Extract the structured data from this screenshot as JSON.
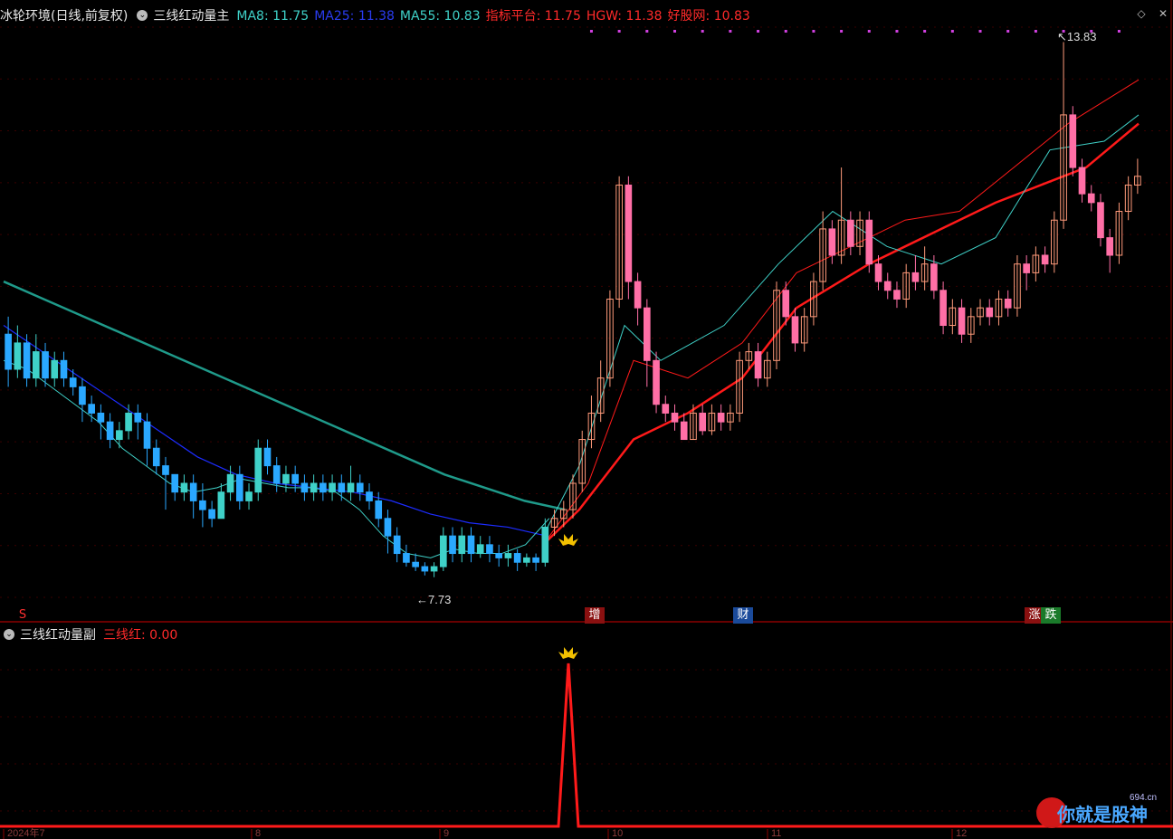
{
  "main_panel": {
    "stock_name": "冰轮环境",
    "period": "(日线,前复权)",
    "indicator_name": "三线红动量主",
    "legend": [
      {
        "label": "MA8: 11.75",
        "color": "#3fd1c8"
      },
      {
        "label": "MA25: 11.38",
        "color": "#2a3cf0"
      },
      {
        "label": "MA55: 10.83",
        "color": "#3fd1c8"
      },
      {
        "label": "指标平台: 11.75",
        "color": "#ff2a2a"
      },
      {
        "label": "HGW: 11.38",
        "color": "#ff2a2a"
      },
      {
        "label": "好股网: 10.83",
        "color": "#ff2a2a"
      }
    ],
    "high_label": "13.83",
    "low_label": "7.73",
    "markers": [
      {
        "text": "S",
        "color": "#ff3030",
        "bg": "transparent"
      },
      {
        "text": "增",
        "color": "#fff",
        "bg": "#8a1010"
      },
      {
        "text": "财",
        "color": "#fff",
        "bg": "#1a4a9a"
      },
      {
        "text": "涨",
        "color": "#fff",
        "bg": "#8a1010"
      },
      {
        "text": "跌",
        "color": "#fff",
        "bg": "#1a7a2a"
      }
    ]
  },
  "sub_panel": {
    "indicator_name": "三线红动量副",
    "value_label": "三线红: 0.00"
  },
  "x_axis_labels": [
    "2024年7",
    "8",
    "9",
    "10",
    "11",
    "12"
  ],
  "watermark": {
    "brand": "你就是股神",
    "url": "694.cn"
  },
  "colors": {
    "up": "#ff6fa6",
    "down": "#2aa8ff",
    "up_alt": "#ff9a7a",
    "cyan": "#3fd1c8",
    "blue": "#1c2cff",
    "teal": "#1f9a8a",
    "red": "#ff1a1a",
    "axis": "#8b0000"
  },
  "chart_data": {
    "type": "candlestick",
    "price_range": [
      7.5,
      14.0
    ],
    "candles": [
      [
        10.5,
        10.1,
        10.7,
        9.9
      ],
      [
        10.1,
        10.4,
        10.6,
        10.0
      ],
      [
        10.4,
        10.0,
        10.5,
        9.9
      ],
      [
        10.0,
        10.3,
        10.5,
        9.9
      ],
      [
        10.3,
        10.0,
        10.4,
        9.9
      ],
      [
        10.0,
        10.2,
        10.3,
        9.9
      ],
      [
        10.2,
        10.0,
        10.3,
        9.9
      ],
      [
        10.0,
        9.9,
        10.1,
        9.8
      ],
      [
        9.9,
        9.7,
        10.0,
        9.5
      ],
      [
        9.7,
        9.6,
        9.8,
        9.5
      ],
      [
        9.6,
        9.5,
        9.7,
        9.3
      ],
      [
        9.5,
        9.3,
        9.6,
        9.2
      ],
      [
        9.3,
        9.4,
        9.5,
        9.2
      ],
      [
        9.4,
        9.6,
        9.7,
        9.3
      ],
      [
        9.6,
        9.5,
        9.7,
        9.3
      ],
      [
        9.5,
        9.2,
        9.6,
        9.0
      ],
      [
        9.2,
        9.0,
        9.3,
        8.9
      ],
      [
        9.0,
        8.9,
        9.1,
        8.5
      ],
      [
        8.9,
        8.7,
        8.9,
        8.6
      ],
      [
        8.7,
        8.8,
        8.9,
        8.6
      ],
      [
        8.8,
        8.6,
        8.9,
        8.4
      ],
      [
        8.6,
        8.5,
        8.8,
        8.3
      ],
      [
        8.5,
        8.4,
        8.6,
        8.3
      ],
      [
        8.4,
        8.7,
        8.8,
        8.4
      ],
      [
        8.7,
        8.9,
        9.0,
        8.6
      ],
      [
        8.9,
        8.6,
        9.0,
        8.5
      ],
      [
        8.6,
        8.7,
        8.8,
        8.5
      ],
      [
        8.7,
        9.2,
        9.3,
        8.6
      ],
      [
        9.2,
        9.0,
        9.3,
        8.9
      ],
      [
        9.0,
        8.8,
        9.1,
        8.7
      ],
      [
        8.8,
        8.9,
        9.0,
        8.7
      ],
      [
        8.9,
        8.8,
        9.0,
        8.7
      ],
      [
        8.8,
        8.7,
        8.9,
        8.6
      ],
      [
        8.7,
        8.8,
        8.9,
        8.6
      ],
      [
        8.8,
        8.7,
        8.9,
        8.6
      ],
      [
        8.7,
        8.8,
        8.9,
        8.6
      ],
      [
        8.8,
        8.7,
        8.9,
        8.6
      ],
      [
        8.7,
        8.8,
        9.0,
        8.6
      ],
      [
        8.8,
        8.7,
        8.9,
        8.6
      ],
      [
        8.7,
        8.6,
        8.8,
        8.5
      ],
      [
        8.6,
        8.4,
        8.7,
        8.3
      ],
      [
        8.4,
        8.2,
        8.5,
        8.0
      ],
      [
        8.2,
        8.0,
        8.3,
        7.9
      ],
      [
        8.0,
        7.9,
        8.1,
        7.85
      ],
      [
        7.9,
        7.85,
        8.0,
        7.8
      ],
      [
        7.85,
        7.8,
        7.9,
        7.75
      ],
      [
        7.8,
        7.85,
        7.9,
        7.73
      ],
      [
        7.85,
        8.2,
        8.3,
        7.8
      ],
      [
        8.2,
        8.0,
        8.3,
        7.9
      ],
      [
        8.0,
        8.2,
        8.3,
        7.9
      ],
      [
        8.2,
        8.0,
        8.3,
        7.9
      ],
      [
        8.0,
        8.1,
        8.2,
        7.95
      ],
      [
        8.1,
        8.0,
        8.2,
        7.9
      ],
      [
        8.0,
        7.95,
        8.1,
        7.85
      ],
      [
        7.95,
        8.0,
        8.1,
        7.85
      ],
      [
        8.0,
        7.9,
        8.05,
        7.8
      ],
      [
        7.9,
        7.95,
        8.0,
        7.85
      ],
      [
        7.95,
        7.9,
        8.0,
        7.8
      ],
      [
        7.9,
        8.3,
        8.4,
        7.85
      ],
      [
        8.3,
        8.4,
        8.5,
        8.2
      ],
      [
        8.4,
        8.5,
        8.6,
        8.3
      ],
      [
        8.5,
        8.8,
        8.9,
        8.4
      ],
      [
        8.8,
        9.3,
        9.4,
        8.7
      ],
      [
        9.3,
        9.6,
        9.8,
        9.2
      ],
      [
        9.6,
        10.0,
        10.2,
        9.5
      ],
      [
        10.0,
        10.9,
        11.0,
        9.9
      ],
      [
        10.9,
        12.2,
        12.3,
        10.8
      ],
      [
        12.2,
        11.1,
        12.3,
        10.9
      ],
      [
        11.1,
        10.8,
        11.2,
        10.6
      ],
      [
        10.8,
        10.2,
        10.9,
        9.9
      ],
      [
        10.2,
        9.7,
        10.3,
        9.6
      ],
      [
        9.7,
        9.6,
        9.8,
        9.5
      ],
      [
        9.6,
        9.5,
        9.7,
        9.4
      ],
      [
        9.5,
        9.3,
        9.6,
        9.3
      ],
      [
        9.3,
        9.6,
        9.7,
        9.3
      ],
      [
        9.6,
        9.4,
        9.7,
        9.35
      ],
      [
        9.4,
        9.6,
        9.7,
        9.35
      ],
      [
        9.6,
        9.5,
        9.7,
        9.4
      ],
      [
        9.5,
        9.6,
        9.7,
        9.4
      ],
      [
        9.6,
        10.2,
        10.3,
        9.5
      ],
      [
        10.2,
        10.3,
        10.4,
        10.1
      ],
      [
        10.3,
        10.0,
        10.4,
        9.9
      ],
      [
        10.0,
        10.2,
        10.3,
        9.9
      ],
      [
        10.2,
        11.0,
        11.1,
        10.1
      ],
      [
        11.0,
        10.7,
        11.1,
        10.6
      ],
      [
        10.7,
        10.4,
        10.8,
        10.3
      ],
      [
        10.4,
        10.7,
        10.8,
        10.3
      ],
      [
        10.7,
        11.1,
        11.2,
        10.6
      ],
      [
        11.1,
        11.7,
        11.9,
        11.0
      ],
      [
        11.7,
        11.4,
        11.8,
        11.3
      ],
      [
        11.4,
        11.8,
        12.4,
        11.3
      ],
      [
        11.8,
        11.5,
        11.9,
        11.4
      ],
      [
        11.5,
        11.8,
        11.9,
        11.4
      ],
      [
        11.8,
        11.3,
        11.9,
        11.2
      ],
      [
        11.3,
        11.1,
        11.4,
        11.0
      ],
      [
        11.1,
        11.0,
        11.2,
        10.9
      ],
      [
        11.0,
        10.9,
        11.1,
        10.8
      ],
      [
        10.9,
        11.2,
        11.3,
        10.8
      ],
      [
        11.2,
        11.1,
        11.4,
        11.0
      ],
      [
        11.1,
        11.3,
        11.5,
        11.0
      ],
      [
        11.3,
        11.0,
        11.4,
        10.9
      ],
      [
        11.0,
        10.6,
        11.1,
        10.5
      ],
      [
        10.6,
        10.8,
        10.9,
        10.5
      ],
      [
        10.8,
        10.5,
        10.9,
        10.4
      ],
      [
        10.5,
        10.7,
        10.8,
        10.4
      ],
      [
        10.7,
        10.8,
        10.9,
        10.6
      ],
      [
        10.8,
        10.7,
        10.9,
        10.6
      ],
      [
        10.7,
        10.9,
        11.0,
        10.6
      ],
      [
        10.9,
        10.8,
        11.0,
        10.7
      ],
      [
        10.8,
        11.3,
        11.4,
        10.7
      ],
      [
        11.3,
        11.2,
        11.4,
        11.0
      ],
      [
        11.2,
        11.4,
        11.5,
        11.1
      ],
      [
        11.4,
        11.3,
        11.5,
        11.2
      ],
      [
        11.3,
        11.8,
        11.9,
        11.2
      ],
      [
        11.8,
        13.0,
        13.83,
        11.7
      ],
      [
        13.0,
        12.4,
        13.1,
        12.3
      ],
      [
        12.4,
        12.1,
        12.5,
        12.0
      ],
      [
        12.1,
        12.0,
        12.2,
        11.9
      ],
      [
        12.0,
        11.6,
        12.1,
        11.5
      ],
      [
        11.6,
        11.4,
        11.7,
        11.2
      ],
      [
        11.4,
        11.9,
        12.0,
        11.3
      ],
      [
        11.9,
        12.2,
        12.3,
        11.8
      ],
      [
        12.2,
        12.3,
        12.5,
        12.1
      ]
    ],
    "y_ma8": [
      10.2,
      10.1,
      9.9,
      9.7,
      9.5,
      9.2,
      9.0,
      8.8,
      8.7,
      8.75,
      8.85,
      8.8,
      8.75,
      8.75,
      8.7,
      8.5,
      8.2,
      8.0,
      7.95,
      8.05,
      8.0,
      8.0,
      8.1,
      8.4,
      9.0,
      9.9,
      10.5,
      10.4,
      10.0,
      9.6,
      9.5,
      9.6,
      9.9,
      10.3,
      10.7,
      11.2,
      11.5,
      11.3,
      11.05,
      11.1,
      10.8,
      10.75,
      10.9,
      11.2,
      11.6,
      12.3,
      12.2,
      11.9,
      11.75
    ],
    "sub_values": {
      "spike_index": 0.48,
      "baseline": 0.0,
      "peak": 1.0
    }
  }
}
